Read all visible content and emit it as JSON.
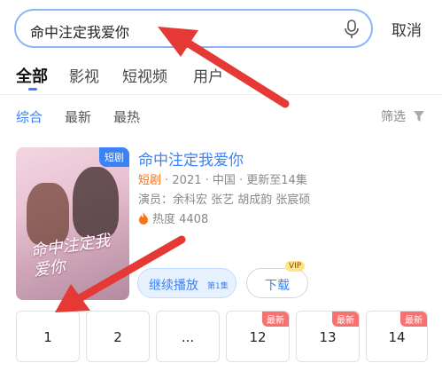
{
  "search": {
    "query": "命中注定我爱你",
    "cancel_label": "取消"
  },
  "tabs": [
    {
      "label": "全部",
      "active": true
    },
    {
      "label": "影视",
      "active": false
    },
    {
      "label": "短视频",
      "active": false
    },
    {
      "label": "用户",
      "active": false
    }
  ],
  "filters": {
    "items": [
      {
        "label": "综合",
        "active": true
      },
      {
        "label": "最新",
        "active": false
      },
      {
        "label": "最热",
        "active": false
      }
    ],
    "filter_label": "筛选"
  },
  "result": {
    "badge": "短剧",
    "title": "命中注定我爱你",
    "poster_title": "命中注定我爱你",
    "type": "短剧",
    "meta": " · 2021 · 中国 · 更新至14集",
    "cast": "演员：余科宏 张艺 胡成韵 张宸硕",
    "heat": "热度 4408",
    "play_label": "继续播放",
    "play_episode": "第1集",
    "download_label": "下载",
    "vip_label": "VIP"
  },
  "episodes": [
    {
      "num": "1",
      "new": ""
    },
    {
      "num": "2",
      "new": ""
    },
    {
      "num": "...",
      "new": ""
    },
    {
      "num": "12",
      "new": "最新"
    },
    {
      "num": "13",
      "new": "最新"
    },
    {
      "num": "14",
      "new": "最新"
    }
  ],
  "colors": {
    "accent": "#3b82f6",
    "arrow": "#e53935",
    "new_badge": "#f87171"
  }
}
